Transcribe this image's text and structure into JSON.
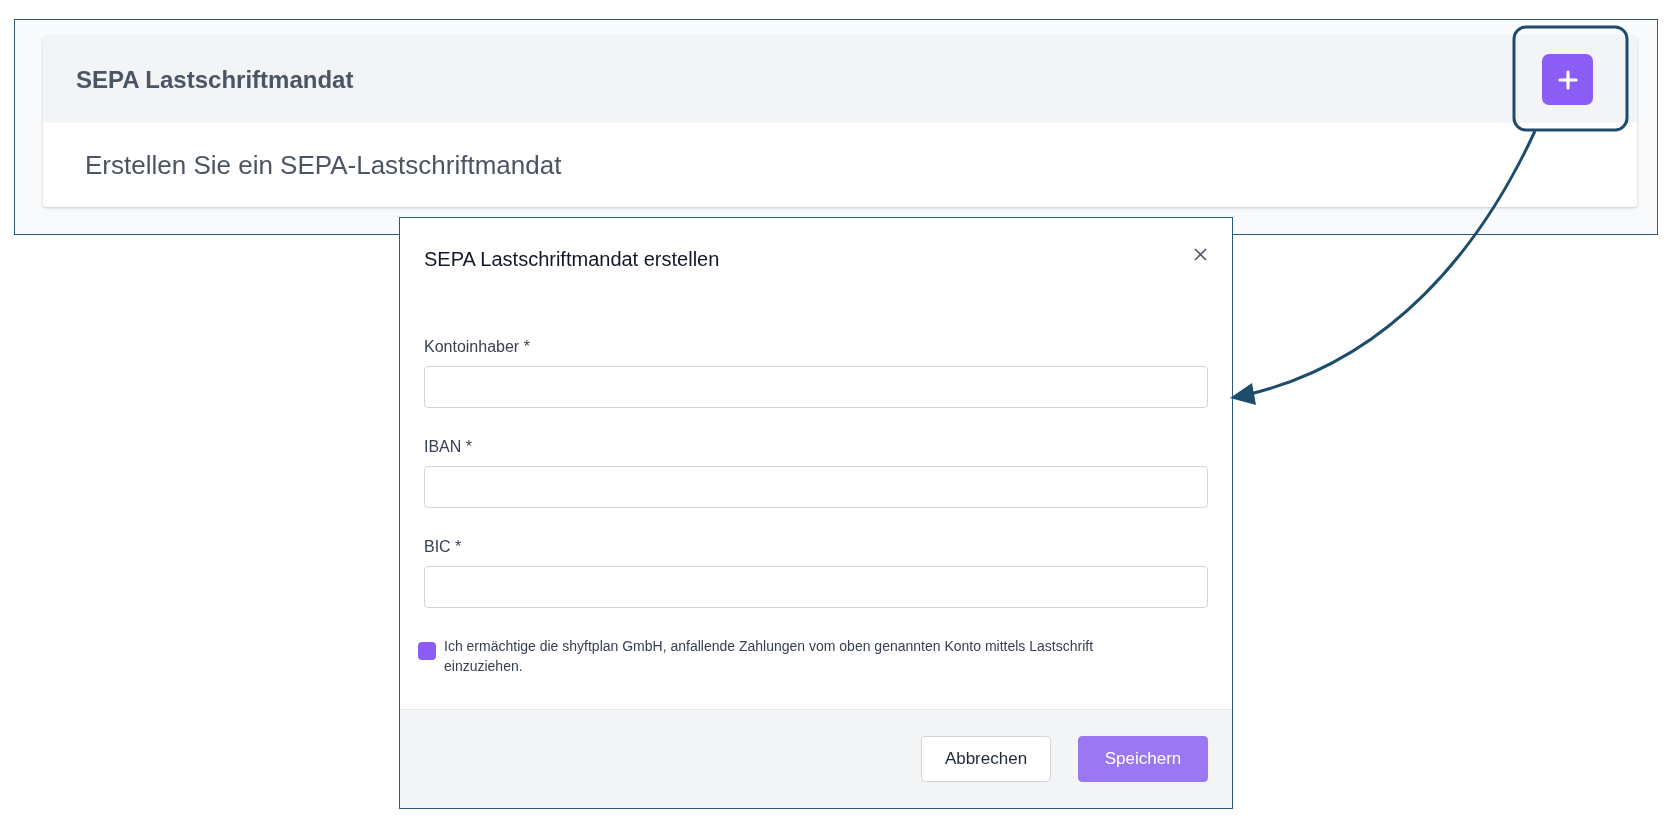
{
  "card": {
    "title": "SEPA Lastschriftmandat",
    "description": "Erstellen Sie ein SEPA-Lastschriftmandat"
  },
  "dialog": {
    "title": "SEPA Lastschriftmandat erstellen",
    "fields": [
      {
        "label": "Kontoinhaber *"
      },
      {
        "label": "IBAN *"
      },
      {
        "label": "BIC *"
      }
    ],
    "consent": {
      "text": "Ich ermächtige die shyftplan GmbH, anfallende Zahlungen vom oben genannten Konto mittels Lastschrift einzuziehen.",
      "checked": false
    },
    "buttons": [
      {
        "label": "Abbrechen",
        "kind": "secondary",
        "disabled": false
      },
      {
        "label": "Speichern",
        "kind": "primary",
        "disabled": true
      }
    ]
  }
}
